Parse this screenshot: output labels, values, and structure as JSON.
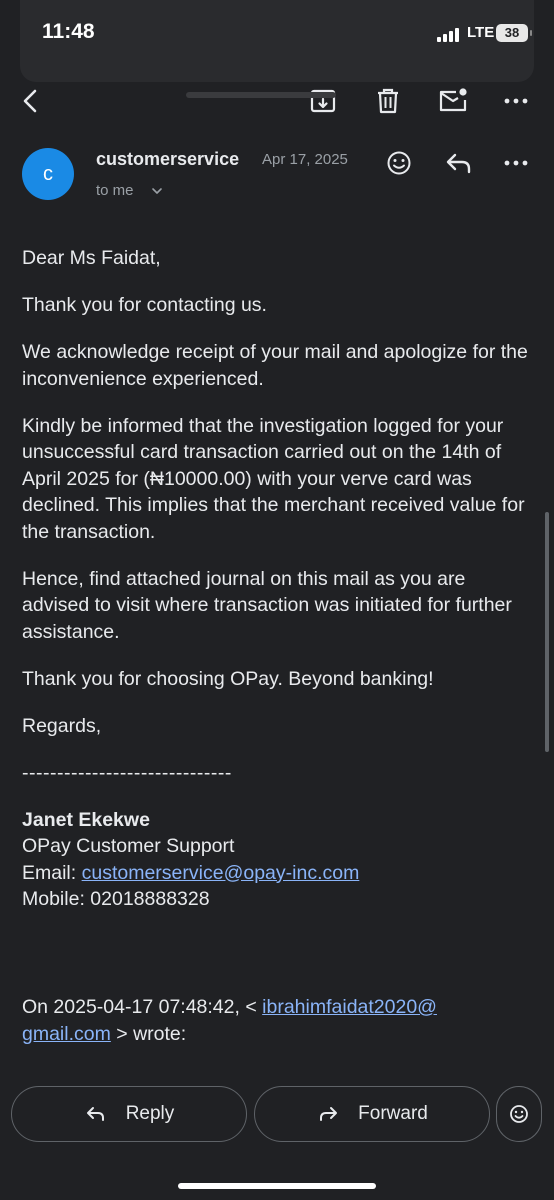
{
  "status_bar": {
    "time": "11:48",
    "network": "LTE",
    "battery": "38"
  },
  "toolbar": {
    "back_icon": "back-arrow-icon",
    "archive_icon": "archive-icon",
    "delete_icon": "trash-icon",
    "mark_unread_icon": "mail-unread-icon",
    "more_icon": "more-horizontal-icon"
  },
  "message": {
    "avatar_letter": "c",
    "sender": "customerservice",
    "date": "Apr 17, 2025",
    "recipient": "to me",
    "body": {
      "greeting": "Dear Ms Faidat,",
      "p1": "Thank you for contacting us.",
      "p2": "We acknowledge receipt of your mail and apologize for the inconvenience experienced.",
      "p3": "Kindly be informed that the investigation logged for your unsuccessful card transaction carried out on the 14th of April 2025 for (₦10000.00) with your verve card was declined. This implies that the merchant received value for the transaction.",
      "p4": "Hence, find attached journal on this mail as you are advised to visit where transaction was initiated for further assistance.",
      "p5": "Thank you for choosing OPay. Beyond banking!",
      "regards": "Regards,",
      "divider": "------------------------------"
    },
    "signature": {
      "name": "Janet Ekekwe",
      "title": "OPay Customer Support",
      "email_label": "Email: ",
      "email": "customerservice@opay-inc.com",
      "mobile": "Mobile: 02018888328"
    },
    "quote": {
      "prefix": "On  2025-04-17 07:48:42, < ",
      "email_part1": "ibrahimfaidat2020@",
      "email_part2": "gmail.com",
      "suffix": " > wrote:"
    }
  },
  "actions": {
    "reply": "Reply",
    "forward": "Forward"
  },
  "colors": {
    "background": "#202124",
    "avatar": "#1a8ae5",
    "link": "#8ab4f8",
    "text": "#e8eaed",
    "muted": "#9aa0a6"
  }
}
